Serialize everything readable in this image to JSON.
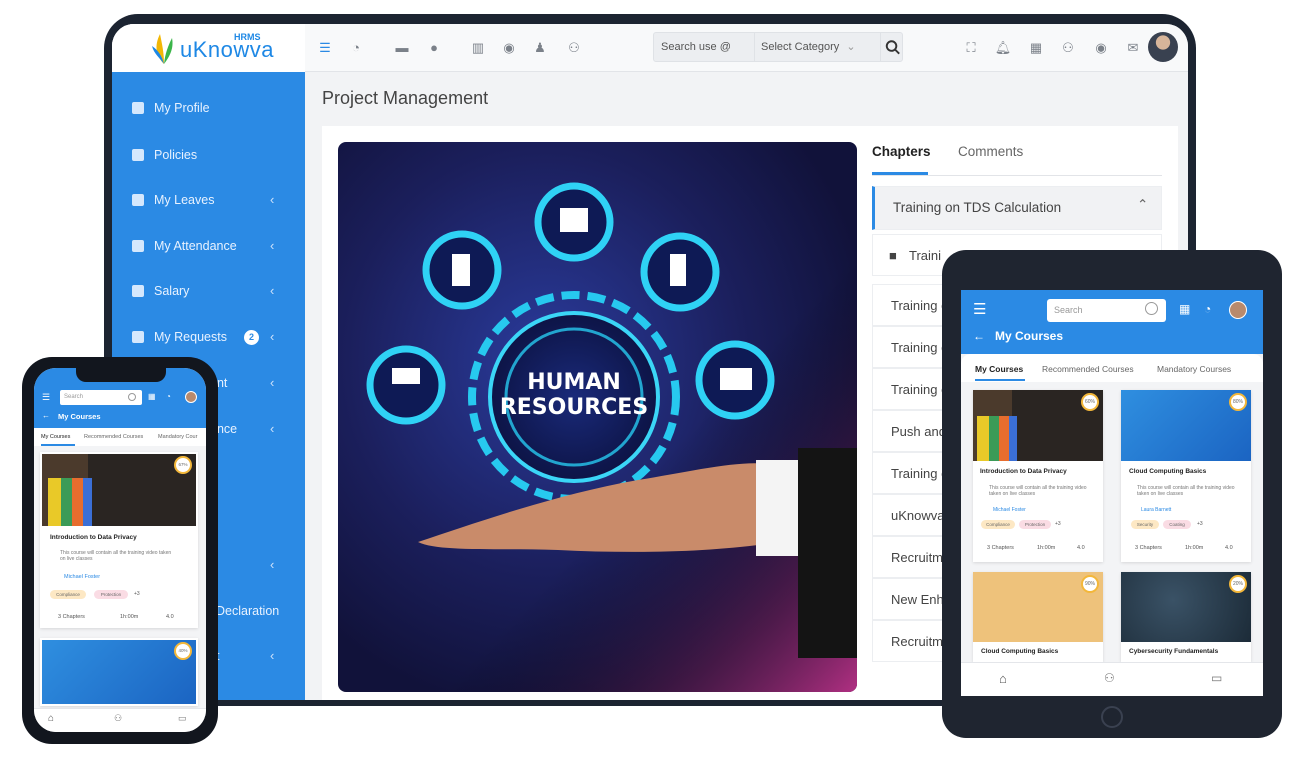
{
  "app": {
    "name": "uKnowva",
    "badge": "HRMS"
  },
  "topbar": {
    "search_placeholder": "Search use @",
    "category_placeholder": "Select Category",
    "left_icons": [
      "sidebar-toggle-icon",
      "rss-icon",
      "folder-icon",
      "info-icon",
      "chart-icon",
      "dashboard-icon",
      "user-icon",
      "users-icon"
    ],
    "right_icons": [
      "scan-icon",
      "bell-icon",
      "calendar-icon",
      "team-icon",
      "gauge-icon",
      "mail-icon",
      "avatar"
    ]
  },
  "sidebar": {
    "items": [
      {
        "label": "My Profile",
        "chevron": false,
        "badge": ""
      },
      {
        "label": "Policies",
        "chevron": false,
        "badge": ""
      },
      {
        "label": "My Leaves",
        "chevron": true,
        "badge": ""
      },
      {
        "label": "My Attendance",
        "chevron": true,
        "badge": ""
      },
      {
        "label": "Salary",
        "chevron": true,
        "badge": ""
      },
      {
        "label": "My Requests",
        "chevron": true,
        "badge": "2"
      },
      {
        "label": "ent",
        "chevron": true,
        "badge": ""
      },
      {
        "label": "ance",
        "chevron": true,
        "badge": ""
      },
      {
        "label": "",
        "chevron": true,
        "badge": ""
      },
      {
        "label": "Declaration",
        "chevron": false,
        "badge": ""
      },
      {
        "label": "t",
        "chevron": true,
        "badge": ""
      }
    ]
  },
  "main": {
    "page_title": "Project Management",
    "hero_text_1": "HUMAN",
    "hero_text_2": "RESOURCES",
    "tabs": [
      {
        "label": "Chapters",
        "active": true
      },
      {
        "label": "Comments",
        "active": false
      }
    ],
    "chapter_open": "Training on TDS Calculation",
    "chapters": [
      "Traini",
      "Training c",
      "Training c",
      "Training c",
      "Push and",
      "Training c",
      "uKnowva",
      "Recruitm",
      "New Enh",
      "Recruitm"
    ]
  },
  "tablet": {
    "search_placeholder": "Search",
    "title": "My Courses",
    "tabs": [
      "My Courses",
      "Recommended Courses",
      "Mandatory Courses"
    ],
    "courses": [
      {
        "title": "Introduction to Data Privacy",
        "desc": "This course will contain all the training video taken on live classes",
        "author": "Michael Foster",
        "tags": [
          "Compliance",
          "Protection"
        ],
        "more": "+3",
        "chapters": "3 Chapters",
        "duration": "1h:00m",
        "rating": "4.0",
        "pct": "60%"
      },
      {
        "title": "Cloud Computing Basics",
        "desc": "This course will contain all the training video taken on live classes",
        "author": "Laura Barnett",
        "tags": [
          "Security",
          "Coating"
        ],
        "more": "+3",
        "chapters": "3 Chapters",
        "duration": "1h:00m",
        "rating": "4.0",
        "pct": "80%"
      },
      {
        "title": "Cloud Computing Basics",
        "pct": "90%"
      },
      {
        "title": "Cybersecurity Fundamentals",
        "pct": "20%"
      }
    ]
  },
  "phone": {
    "search_placeholder": "Search",
    "title": "My Courses",
    "tabs": [
      "My Courses",
      "Recommended Courses",
      "Mandatory Cour"
    ],
    "course": {
      "title": "Introduction to Data Privacy",
      "desc": "This course will contain all the training video taken on live classes",
      "author": "Michael Foster",
      "tags": [
        "Compliance",
        "Protection"
      ],
      "more": "+3",
      "chapters": "3 Chapters",
      "duration": "1h:00m",
      "rating": "4.0",
      "pct": "67%"
    },
    "course2_pct": "40%"
  },
  "colors": {
    "brand": "#2b8ae4",
    "sidebar": "#2b8ae4",
    "device": "#1c2431"
  }
}
